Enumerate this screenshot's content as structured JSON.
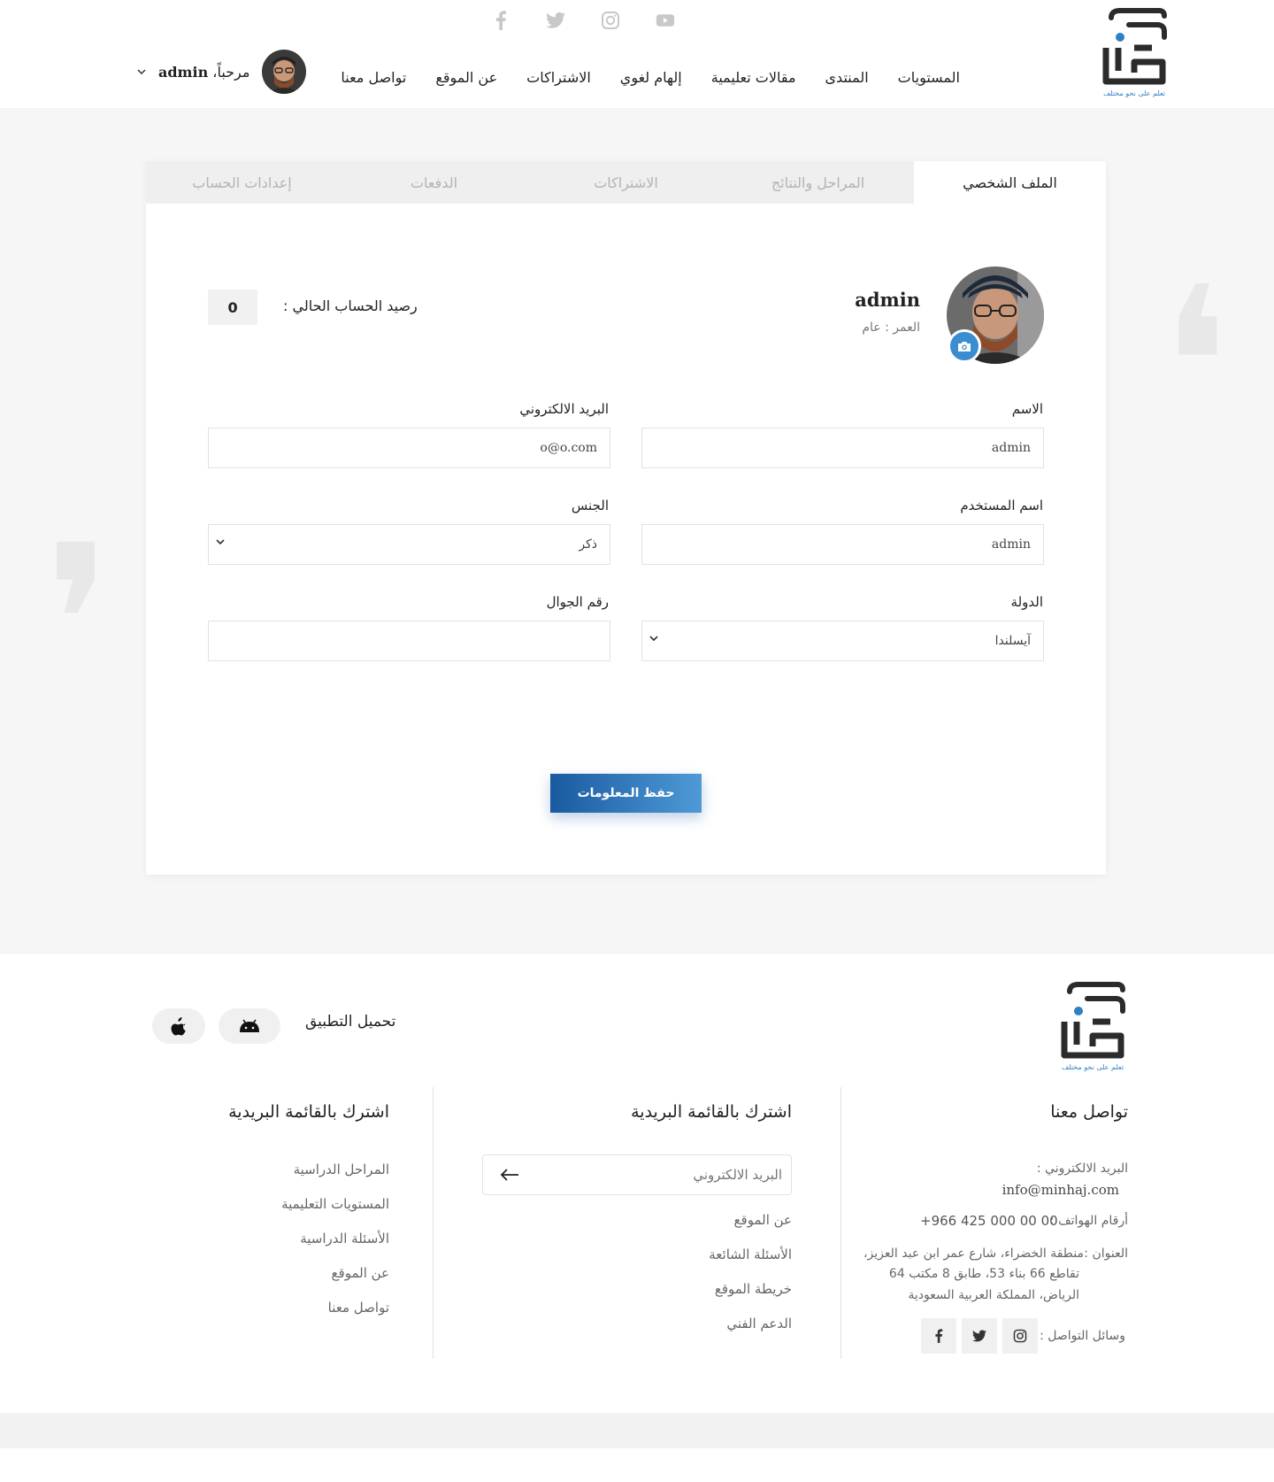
{
  "header": {
    "nav": [
      "المستويات",
      "المنتدى",
      "مقالات تعليمية",
      "إلهام لغوي",
      "الاشتراكات",
      "عن الموقع",
      "تواصل معنا"
    ],
    "welcome_prefix": "مرحباً،",
    "user_name": "admin",
    "logo_tagline": "تعلم على نحو مختلف"
  },
  "tabs": [
    "الملف الشخصي",
    "المراحل والنتائج",
    "الاشتراكات",
    "الدفعات",
    "إعدادات الحساب"
  ],
  "profile": {
    "name": "admin",
    "age_label": "العمر : عام",
    "balance_label": "رصيد الحساب الحالي :",
    "balance_value": "0"
  },
  "form": {
    "name_label": "الاسم",
    "name_value": "admin",
    "email_label": "البريد الالكتروني",
    "email_value": "o@o.com",
    "username_label": "اسم المستخدم",
    "username_value": "admin",
    "gender_label": "الجنس",
    "gender_value": "ذكر",
    "country_label": "الدولة",
    "country_value": "آيسلندا",
    "phone_label": "رقم الجوال",
    "phone_value": "",
    "save_label": "حفظ المعلومات"
  },
  "footer": {
    "app_label": "تحميل التطبيق",
    "contact_title": "تواصل معنا",
    "email_label": "البريد الالكتروني :",
    "email_value": "info@minhaj.com",
    "phones_label": "أرقام الهواتف :",
    "phones_value": "+966 425 000 00 00",
    "address_label": "العنوان :",
    "address_line1": "منطقة الخضراء، شارع عمر ابن عبد العزيز،",
    "address_line2": "تقاطع 66 بناء 53، طابق 8 مكتب 64",
    "address_line3": "الرياض، المملكة العربية السعودية",
    "social_label": "وسائل التواصل :",
    "newsletter_title": "اشترك بالقائمة البريدية",
    "newsletter_placeholder": "البريد الالكتروني",
    "middle_links": [
      "عن الموقع",
      "الأسئلة الشائعة",
      "خريطة الموقع",
      "الدعم الفني"
    ],
    "left_title": "اشترك بالقائمة البريدية",
    "left_links": [
      "المراحل الدراسية",
      "المستويات التعليمية",
      "الأسئلة الدراسية",
      "عن الموقع",
      "تواصل معنا"
    ]
  },
  "icons": {
    "top_social": [
      "facebook-icon",
      "twitter-icon",
      "instagram-icon",
      "youtube-icon"
    ],
    "footer_social": [
      "instagram-icon",
      "twitter-icon",
      "facebook-icon"
    ],
    "app_stores": [
      "android-icon",
      "apple-icon"
    ]
  },
  "colors": {
    "accent": "#2f7fc4",
    "logo": "#2b2b2b",
    "button_start": "#1a5aa0",
    "button_end": "#4e9ad6"
  }
}
